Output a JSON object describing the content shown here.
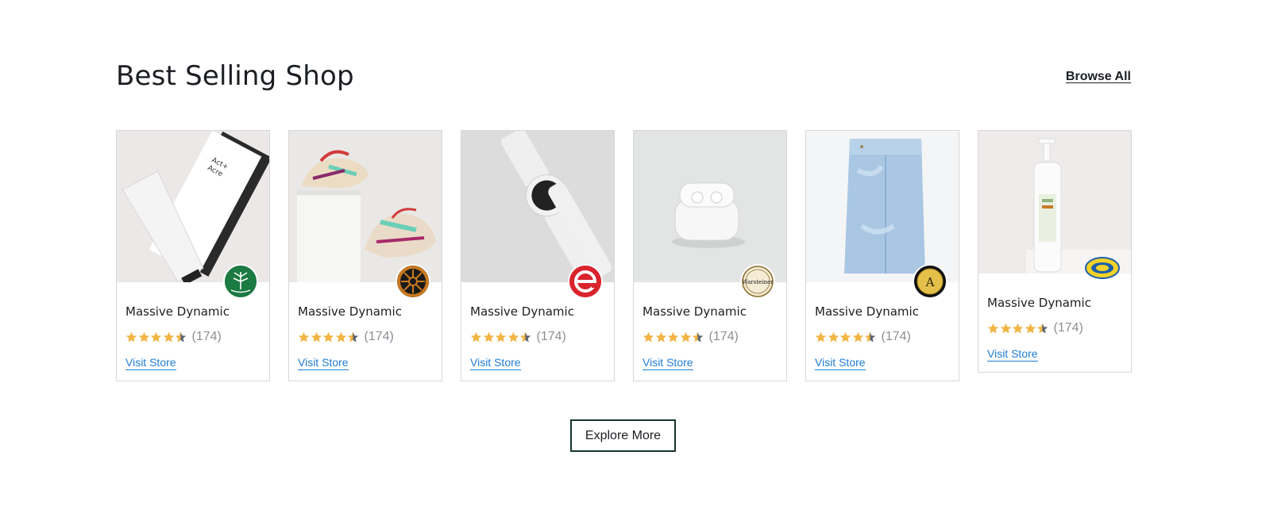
{
  "section": {
    "title": "Best Selling Shop",
    "browse_all": "Browse All"
  },
  "rating_value": 4.5,
  "shops": [
    {
      "name": "Massive Dynamic",
      "rating_count": "(174)",
      "visit_label": "Visit Store",
      "product": "hair-mask-tubes",
      "logo": "round-river-tree-logo"
    },
    {
      "name": "Massive Dynamic",
      "rating_count": "(174)",
      "visit_label": "Visit Store",
      "product": "sneakers",
      "logo": "wheel-badge-logo"
    },
    {
      "name": "Massive Dynamic",
      "rating_count": "(174)",
      "visit_label": "Visit Store",
      "product": "smartwatch",
      "logo": "red-e-logo"
    },
    {
      "name": "Massive Dynamic",
      "rating_count": "(174)",
      "visit_label": "Visit Store",
      "product": "earbuds-case",
      "logo": "warsteiner-seal-logo",
      "logo_text": "Warsteiner"
    },
    {
      "name": "Massive Dynamic",
      "rating_count": "(174)",
      "visit_label": "Visit Store",
      "product": "folded-jeans",
      "logo": "gold-a-coin-logo",
      "logo_text": "A"
    },
    {
      "name": "Massive Dynamic",
      "rating_count": "(174)",
      "visit_label": "Visit Store",
      "product": "pump-bottle",
      "logo": "custom-badge-logo"
    }
  ],
  "explore_label": "Explore More",
  "colors": {
    "star": "#f2b544",
    "star_empty": "#5b6470",
    "link": "#1f7dd4",
    "button_border": "#17352a"
  }
}
